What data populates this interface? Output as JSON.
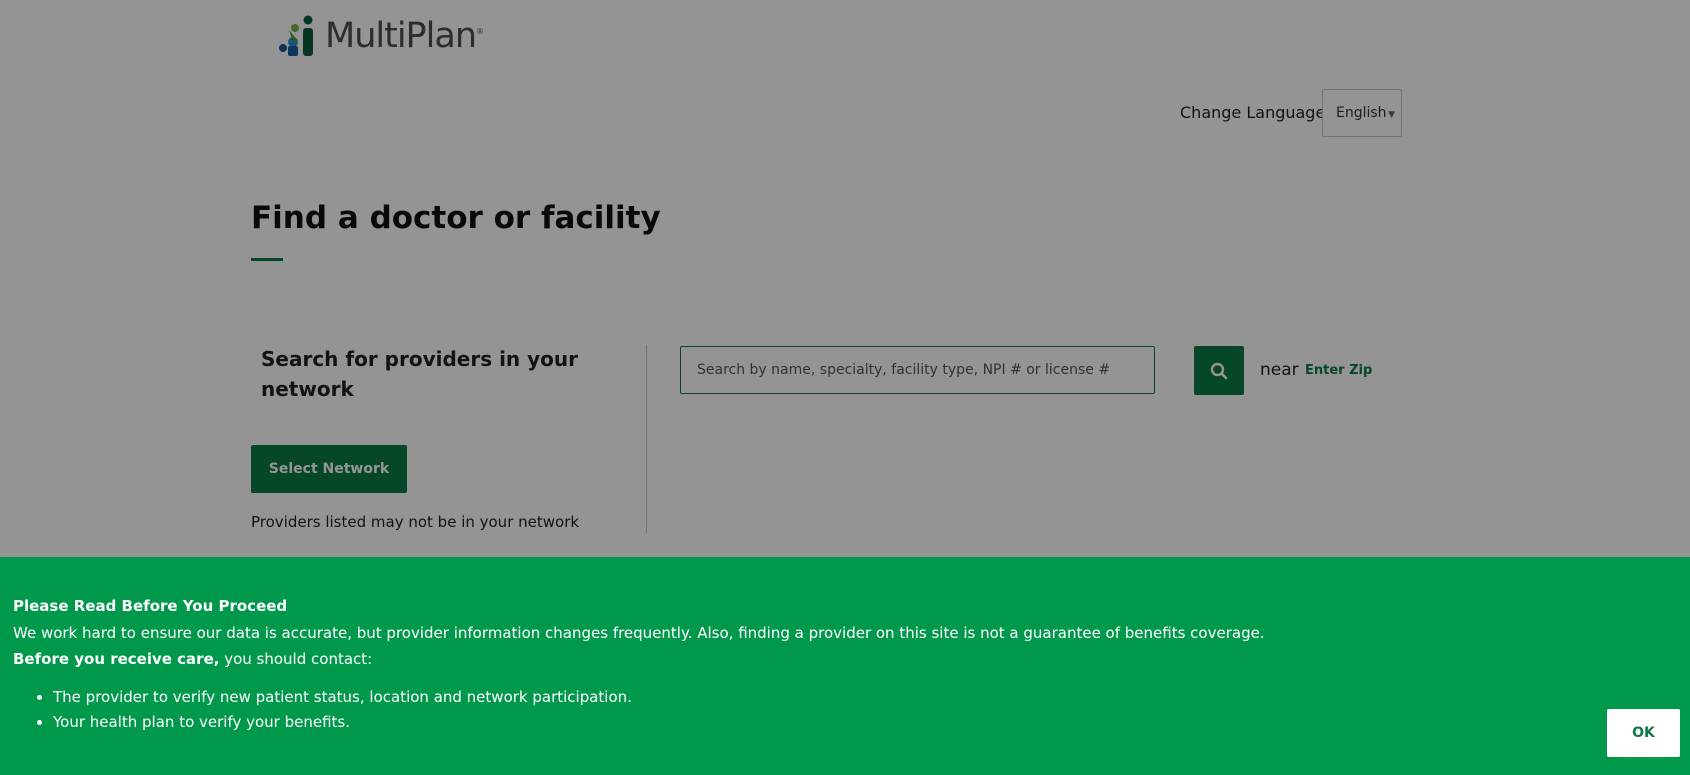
{
  "header": {
    "logo_text": "MultiPlan",
    "logo_reg": "®",
    "change_language_label": "Change Language",
    "language_selected": "English"
  },
  "main": {
    "title": "Find a doctor or facility",
    "network_heading": "Search for providers in your network",
    "select_network_label": "Select Network",
    "network_note": "Providers listed may not be in your network",
    "search_placeholder": "Search by name, specialty, facility type, NPI # or license #",
    "near_label": "near",
    "enter_zip_label": "Enter Zip"
  },
  "banner": {
    "title": "Please Read Before You Proceed",
    "body": "We work hard to ensure our data is accurate, but provider information changes frequently. Also, finding a provider on this site is not a guarantee of benefits coverage.",
    "contact_bold": "Before you receive care,",
    "contact_rest": " you should contact:",
    "items": [
      "The provider to verify new patient status, location and network participation.",
      "Your health plan to verify your benefits."
    ],
    "ok_label": "OK"
  },
  "colors": {
    "brand_green": "#0b7a44",
    "banner_green": "#00994c"
  },
  "icons": {
    "search": "search-icon",
    "caret": "chevron-down-icon",
    "logo": "multiplan-logo"
  }
}
